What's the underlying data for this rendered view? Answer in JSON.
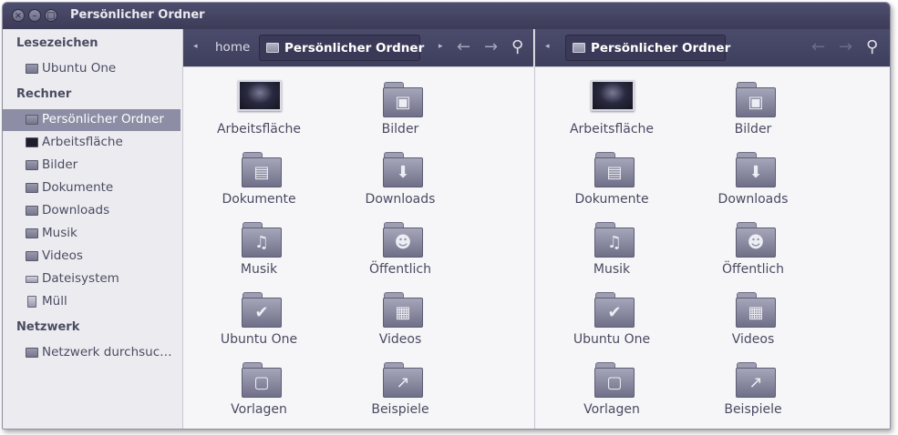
{
  "window": {
    "title": "Persönlicher Ordner"
  },
  "sidebar": {
    "sections": [
      {
        "title": "Lesezeichen",
        "items": [
          {
            "label": "Ubuntu One",
            "icon": "folder-icon"
          }
        ]
      },
      {
        "title": "Rechner",
        "items": [
          {
            "label": "Persönlicher Ordner",
            "icon": "home-folder-icon",
            "selected": true
          },
          {
            "label": "Arbeitsfläche",
            "icon": "desktop-icon"
          },
          {
            "label": "Bilder",
            "icon": "pictures-folder-icon"
          },
          {
            "label": "Dokumente",
            "icon": "documents-folder-icon"
          },
          {
            "label": "Downloads",
            "icon": "downloads-folder-icon"
          },
          {
            "label": "Musik",
            "icon": "music-folder-icon"
          },
          {
            "label": "Videos",
            "icon": "videos-folder-icon"
          },
          {
            "label": "Dateisystem",
            "icon": "drive-icon"
          },
          {
            "label": "Müll",
            "icon": "trash-icon"
          }
        ]
      },
      {
        "title": "Netzwerk",
        "items": [
          {
            "label": "Netzwerk durchsuc…",
            "icon": "network-icon"
          }
        ]
      }
    ]
  },
  "left_pane": {
    "breadcrumb": {
      "parent": "home",
      "current": "Persönlicher Ordner"
    },
    "files": [
      {
        "label": "Arbeitsfläche",
        "icon": "desktop-icon"
      },
      {
        "label": "Bilder",
        "icon": "pictures-folder-icon"
      },
      {
        "label": "Dokumente",
        "icon": "documents-folder-icon"
      },
      {
        "label": "Downloads",
        "icon": "downloads-folder-icon"
      },
      {
        "label": "Musik",
        "icon": "music-folder-icon"
      },
      {
        "label": "Öffentlich",
        "icon": "public-folder-icon"
      },
      {
        "label": "Ubuntu One",
        "icon": "ubuntuone-folder-icon"
      },
      {
        "label": "Videos",
        "icon": "videos-folder-icon"
      },
      {
        "label": "Vorlagen",
        "icon": "templates-folder-icon"
      },
      {
        "label": "Beispiele",
        "icon": "examples-folder-icon"
      }
    ]
  },
  "right_pane": {
    "breadcrumb": {
      "current": "Persönlicher Ordner"
    },
    "files": [
      {
        "label": "Arbeitsfläche",
        "icon": "desktop-icon"
      },
      {
        "label": "Bilder",
        "icon": "pictures-folder-icon"
      },
      {
        "label": "Dokumente",
        "icon": "documents-folder-icon"
      },
      {
        "label": "Downloads",
        "icon": "downloads-folder-icon"
      },
      {
        "label": "Musik",
        "icon": "music-folder-icon"
      },
      {
        "label": "Öffentlich",
        "icon": "public-folder-icon"
      },
      {
        "label": "Ubuntu One",
        "icon": "ubuntuone-folder-icon"
      },
      {
        "label": "Videos",
        "icon": "videos-folder-icon"
      },
      {
        "label": "Vorlagen",
        "icon": "templates-folder-icon"
      },
      {
        "label": "Beispiele",
        "icon": "examples-folder-icon"
      }
    ]
  },
  "colors": {
    "titlebar": "#3c3c58",
    "sidebar_selected": "#8d8da5",
    "text": "#4a4a62"
  }
}
